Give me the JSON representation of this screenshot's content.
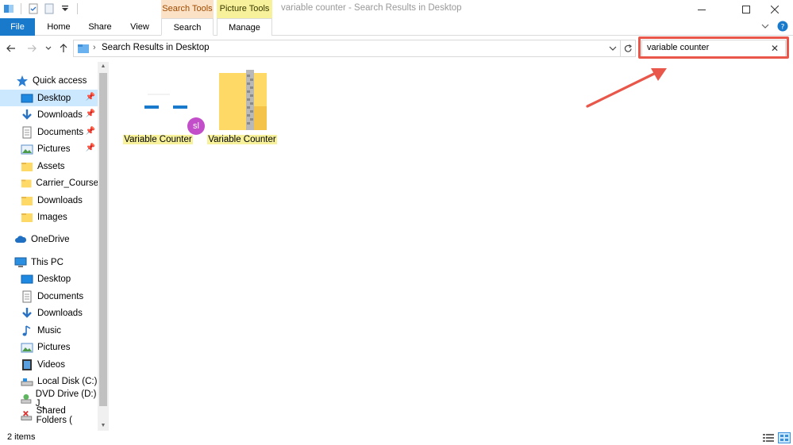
{
  "window": {
    "title": "variable counter - Search Results in Desktop",
    "context_tabs": {
      "search_tools": "Search Tools",
      "picture_tools": "Picture Tools"
    }
  },
  "ribbon": {
    "tabs": [
      "File",
      "Home",
      "Share",
      "View",
      "Search",
      "Manage"
    ]
  },
  "address": {
    "path": "Search Results in Desktop"
  },
  "search": {
    "value": "variable counter"
  },
  "sidebar": {
    "quick_access": "Quick access",
    "quick_items": [
      "Desktop",
      "Downloads",
      "Documents",
      "Pictures",
      "Assets",
      "Carrier_Course",
      "Downloads",
      "Images"
    ],
    "onedrive": "OneDrive",
    "this_pc": "This PC",
    "pc_items": [
      "Desktop",
      "Documents",
      "Downloads",
      "Music",
      "Pictures",
      "Videos",
      "Local Disk (C:)",
      "DVD Drive (D:) J_",
      "Shared Folders ("
    ]
  },
  "files": [
    {
      "name": "Variable Counter",
      "avatar": "sl"
    },
    {
      "name": "Variable Counter"
    }
  ],
  "status": {
    "item_count": "2 items"
  },
  "colors": {
    "file_tab": "#1979ca",
    "selection": "#cce8ff",
    "highlight": "#f6f19a",
    "annotation": "#e8574a",
    "avatar": "#c34ec9"
  }
}
